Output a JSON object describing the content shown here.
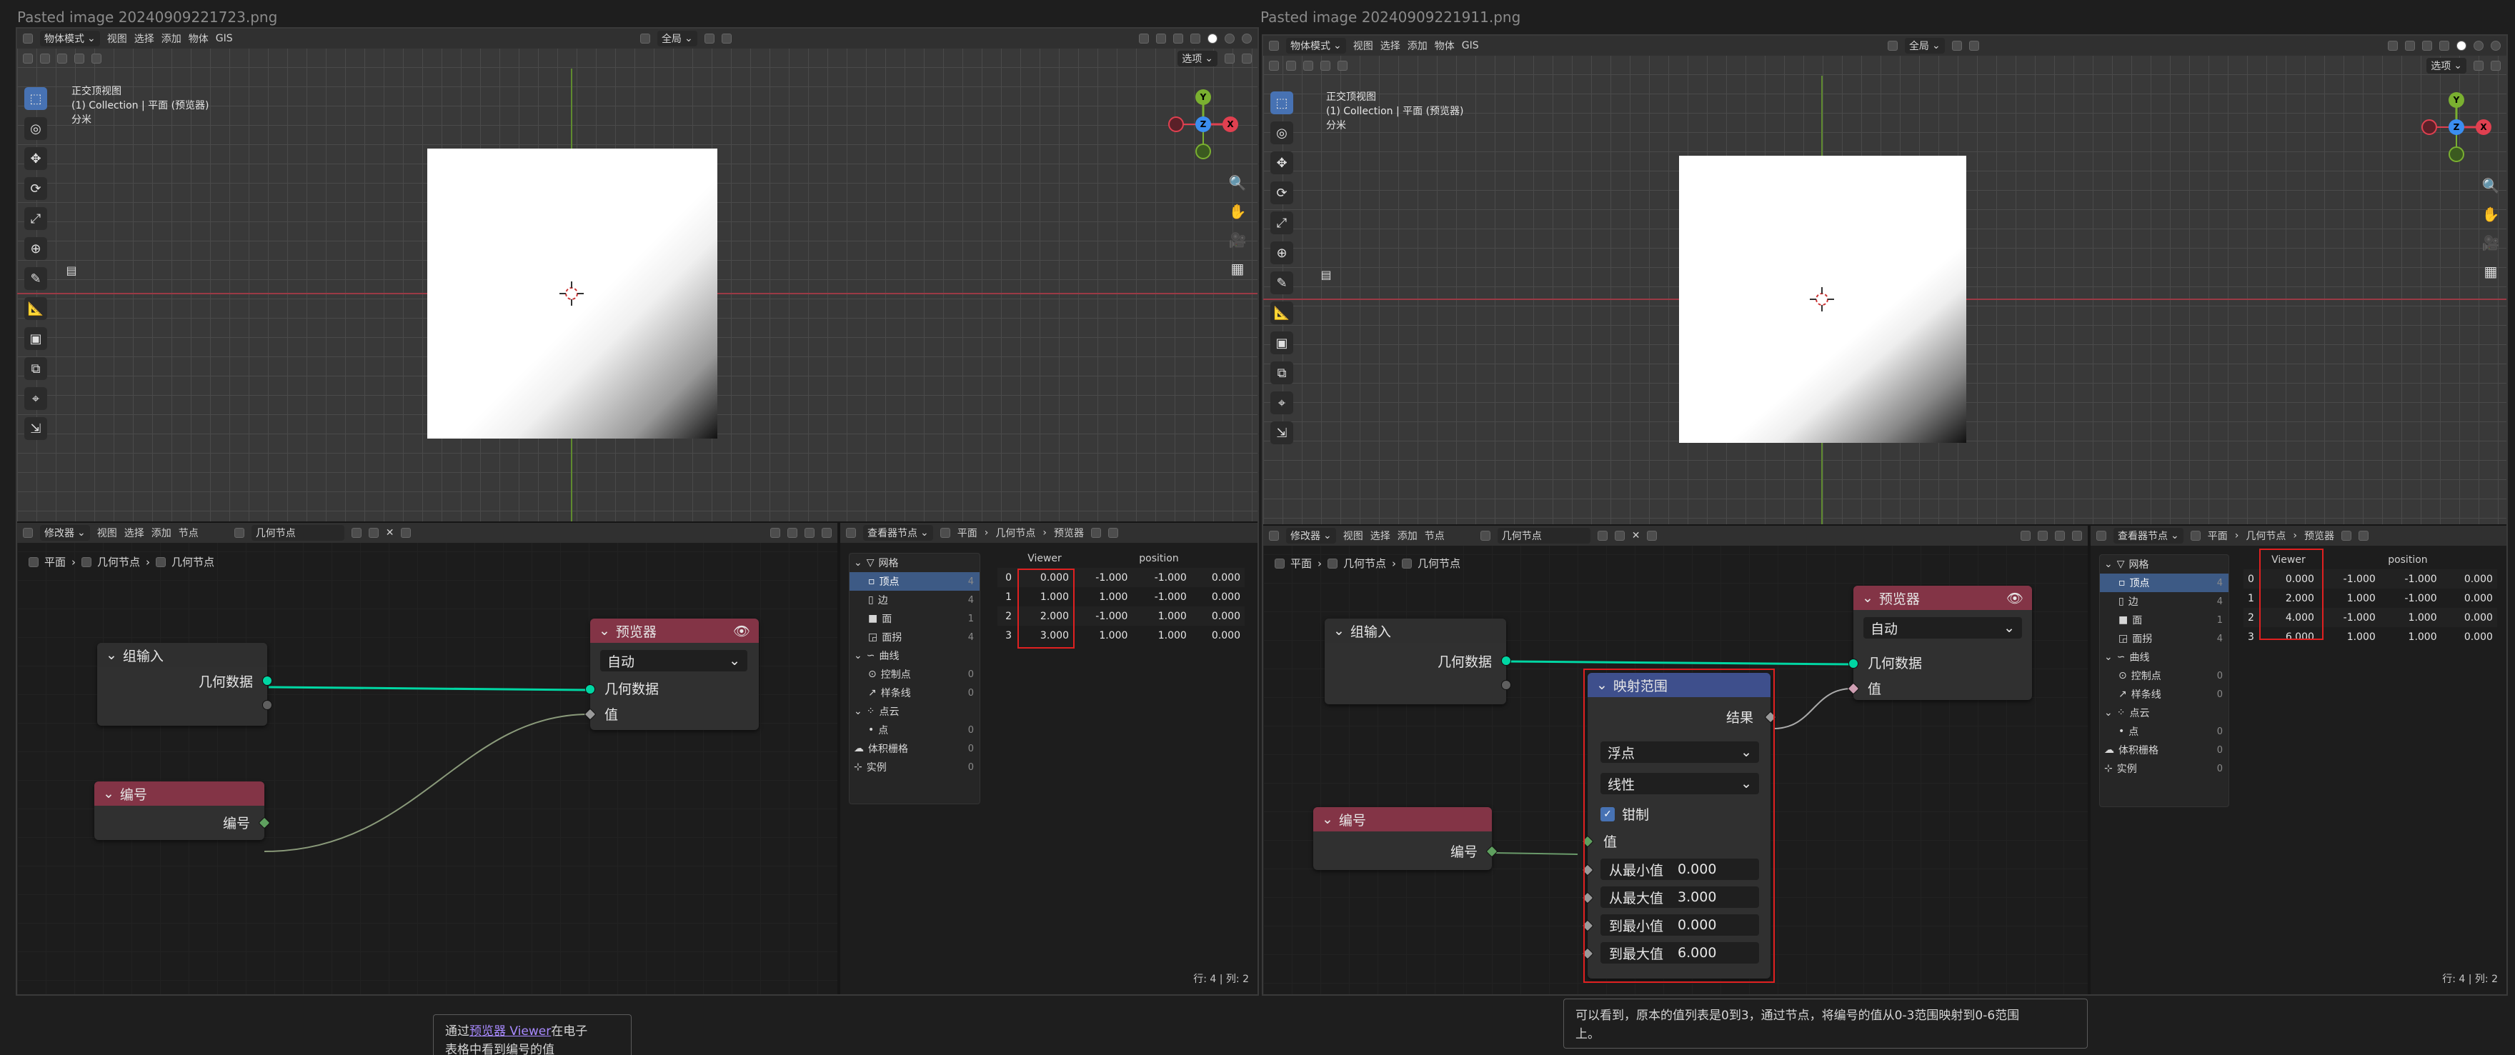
{
  "colors": {
    "accent_blue": "#4772b3",
    "node_red": "#833446",
    "node_blue": "#3e4f8c",
    "socket_green": "#00d6a3",
    "highlight_red": "#e02020",
    "x_axis": "#e04050",
    "y_axis": "#7ab030",
    "z_axis": "#3b8ef0"
  },
  "left": {
    "filename": "Pasted image 20240909221723.png",
    "viewport": {
      "mode": "物体模式",
      "menus": [
        "视图",
        "选择",
        "添加",
        "物体",
        "GIS"
      ],
      "transform": "全局",
      "options": "选项",
      "overlay_lines": [
        "正交顶视图",
        "(1) Collection | 平面 (预览器)",
        "分米"
      ],
      "gizmo": {
        "z": "Z",
        "y": "Y",
        "x": "X"
      }
    },
    "node_editor": {
      "editor": "修改器",
      "menus": [
        "视图",
        "选择",
        "添加",
        "节点"
      ],
      "tree_name": "几何节点",
      "breadcrumb": [
        "平面",
        "几何节点",
        "几何节点"
      ],
      "group_input": {
        "title": "组输入",
        "out": "几何数据"
      },
      "viewer": {
        "title": "预览器",
        "domain": "自动",
        "in_geo": "几何数据",
        "in_val": "值"
      },
      "index": {
        "title": "编号",
        "out": "编号"
      }
    },
    "spreadsheet": {
      "editor": "查看器节点",
      "breadcrumb": [
        "平面",
        "几何节点",
        "预览器"
      ],
      "tree": [
        {
          "label": "网格",
          "count": ""
        },
        {
          "label": "顶点",
          "count": "4"
        },
        {
          "label": "边",
          "count": "4"
        },
        {
          "label": "面",
          "count": "1"
        },
        {
          "label": "面拐",
          "count": "4"
        },
        {
          "label": "曲线",
          "count": ""
        },
        {
          "label": "控制点",
          "count": "0"
        },
        {
          "label": "样条线",
          "count": "0"
        },
        {
          "label": "点云",
          "count": ""
        },
        {
          "label": "点",
          "count": "0"
        },
        {
          "label": "体积栅格",
          "count": "0"
        },
        {
          "label": "实例",
          "count": "0"
        }
      ],
      "columns": [
        "",
        "Viewer",
        "position",
        "",
        ""
      ],
      "rows": [
        [
          "0",
          "0.000",
          "-1.000",
          "-1.000",
          "0.000"
        ],
        [
          "1",
          "1.000",
          "1.000",
          "-1.000",
          "0.000"
        ],
        [
          "2",
          "2.000",
          "-1.000",
          "1.000",
          "0.000"
        ],
        [
          "3",
          "3.000",
          "1.000",
          "1.000",
          "0.000"
        ]
      ],
      "status_rows": "行: 4",
      "status_cols": "列: 2"
    },
    "comment": {
      "pre": "通过",
      "link": "预览器 Viewer",
      "post": "在电子",
      "line2": "表格中看到编号的值"
    }
  },
  "right": {
    "filename": "Pasted image 20240909221911.png",
    "viewport": {
      "mode": "物体模式",
      "menus": [
        "视图",
        "选择",
        "添加",
        "物体",
        "GIS"
      ],
      "transform": "全局",
      "options": "选项",
      "overlay_lines": [
        "正交顶视图",
        "(1) Collection | 平面 (预览器)",
        "分米"
      ],
      "gizmo": {
        "z": "Z",
        "y": "Y",
        "x": "X"
      }
    },
    "node_editor": {
      "editor": "修改器",
      "menus": [
        "视图",
        "选择",
        "添加",
        "节点"
      ],
      "tree_name": "几何节点",
      "breadcrumb": [
        "平面",
        "几何节点",
        "几何节点"
      ],
      "group_input": {
        "title": "组输入",
        "out": "几何数据"
      },
      "viewer": {
        "title": "预览器",
        "domain": "自动",
        "in_geo": "几何数据",
        "in_val": "值"
      },
      "index": {
        "title": "编号",
        "out": "编号"
      },
      "map_range": {
        "title": "映射范围",
        "out": "结果",
        "type": "浮点",
        "interp": "线性",
        "clamp": "钳制",
        "in_val": "值",
        "fields": [
          {
            "label": "从最小值",
            "value": "0.000"
          },
          {
            "label": "从最大值",
            "value": "3.000"
          },
          {
            "label": "到最小值",
            "value": "0.000"
          },
          {
            "label": "到最大值",
            "value": "6.000"
          }
        ]
      }
    },
    "spreadsheet": {
      "editor": "查看器节点",
      "breadcrumb": [
        "平面",
        "几何节点",
        "预览器"
      ],
      "tree": [
        {
          "label": "网格",
          "count": ""
        },
        {
          "label": "顶点",
          "count": "4"
        },
        {
          "label": "边",
          "count": "4"
        },
        {
          "label": "面",
          "count": "1"
        },
        {
          "label": "面拐",
          "count": "4"
        },
        {
          "label": "曲线",
          "count": ""
        },
        {
          "label": "控制点",
          "count": "0"
        },
        {
          "label": "样条线",
          "count": "0"
        },
        {
          "label": "点云",
          "count": ""
        },
        {
          "label": "点",
          "count": "0"
        },
        {
          "label": "体积栅格",
          "count": "0"
        },
        {
          "label": "实例",
          "count": "0"
        }
      ],
      "columns": [
        "",
        "Viewer",
        "position",
        "",
        ""
      ],
      "rows": [
        [
          "0",
          "0.000",
          "-1.000",
          "-1.000",
          "0.000"
        ],
        [
          "1",
          "2.000",
          "1.000",
          "-1.000",
          "0.000"
        ],
        [
          "2",
          "4.000",
          "-1.000",
          "1.000",
          "0.000"
        ],
        [
          "3",
          "6.000",
          "1.000",
          "1.000",
          "0.000"
        ]
      ],
      "status_rows": "行: 4",
      "status_cols": "列: 2"
    },
    "comment": {
      "line1": "可以看到，原本的值列表是0到3，通过节点，将编号的值从0-3范围映射到0-6范围",
      "line2": "上。"
    }
  }
}
